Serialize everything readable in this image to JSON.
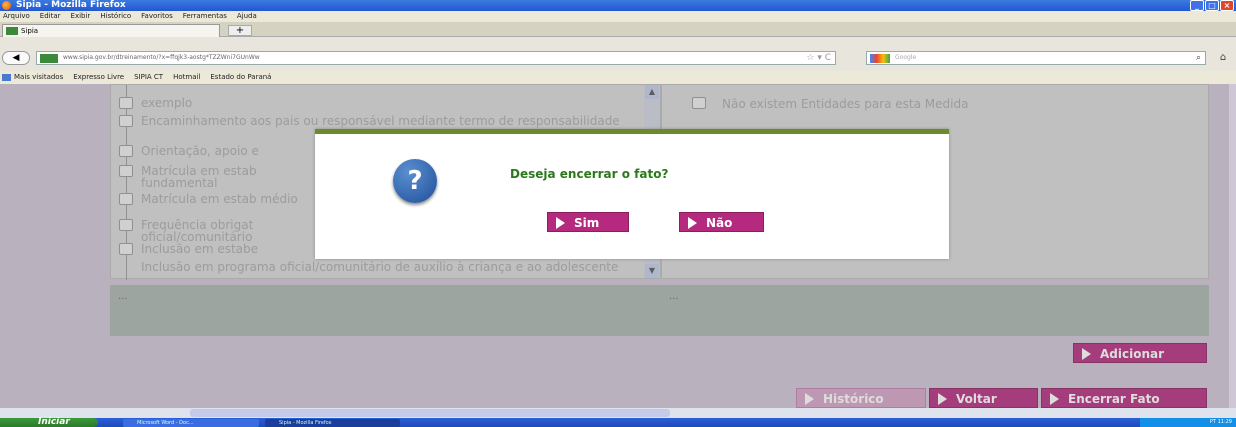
{
  "window": {
    "title": "Sipia - Mozilla Firefox"
  },
  "menubar": [
    "Arquivo",
    "Editar",
    "Exibir",
    "Histórico",
    "Favoritos",
    "Ferramentas",
    "Ajuda"
  ],
  "tab": {
    "label": "Sipia",
    "new_tab": "+"
  },
  "nav": {
    "back": "◀",
    "url": "www.sipia.gov.br/dtreinamento/?x=ffqjk3-aostg*TZZWni7GUnWw",
    "search_placeholder": "Google"
  },
  "bookmarks": [
    "Mais visitados",
    "Expresso Livre",
    "SIPIA CT",
    "Hotmail",
    "Estado do Paraná"
  ],
  "left_tree": [
    "exemplo",
    "Encaminhamento aos pais ou responsável mediante termo de responsabilidade",
    "Orientação, apoio e",
    "Matrícula em estab fundamental",
    "Matrícula em estab médio",
    "Frequência obrigat oficial/comunitário",
    "Inclusão em estabe",
    "Inclusão em programa oficial/comunitário de auxílio à criança e ao adolescente"
  ],
  "right_panel": {
    "empty_text": "Não existem Entidades para esta Medida"
  },
  "notes": {
    "left": "...",
    "right": "..."
  },
  "buttons": {
    "adicionar": "Adicionar",
    "historico": "Histórico",
    "voltar": "Voltar",
    "encerrar": "Encerrar Fato"
  },
  "dialog": {
    "icon_text": "?",
    "message": "Deseja encerrar o fato?",
    "yes": "Sim",
    "no": "Não"
  },
  "taskbar": {
    "start": "Iniciar",
    "items": [
      "Microsoft Word - Doc...",
      "Sipia - Mozilla Firefox"
    ],
    "clock": "PT 11:29"
  }
}
